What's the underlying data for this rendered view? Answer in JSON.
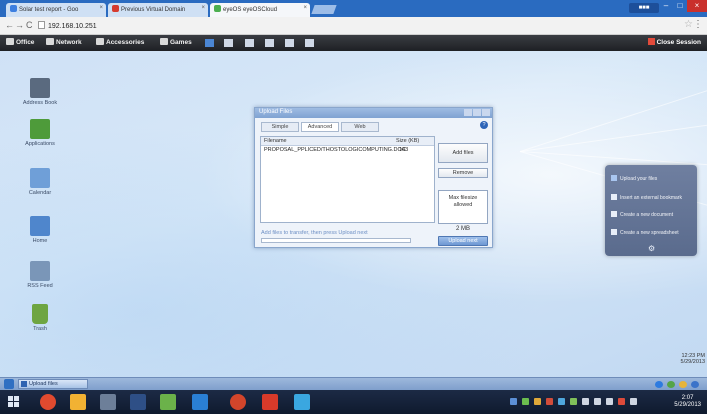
{
  "browser": {
    "tabs": [
      {
        "label": "Solar test report - Goo"
      },
      {
        "label": "Previous Virtual Domain"
      },
      {
        "label": "eyeOS eyeOSCloud"
      }
    ],
    "user_badge": "■■■",
    "address": "192.168.10.251",
    "star": "☆",
    "menu": "⋮"
  },
  "appbar": {
    "items": [
      "Office",
      "Network",
      "Accessories",
      "Games"
    ],
    "close_session": "Close Session"
  },
  "desktop_icons": [
    {
      "label": "Address Book",
      "color": "#5a6a7f"
    },
    {
      "label": "Applications",
      "color": "#4e9b3a"
    },
    {
      "label": "Calendar",
      "color": "#6f9fd8"
    },
    {
      "label": "Home",
      "color": "#4f86cc"
    },
    {
      "label": "RSS Feed",
      "color": "#7a96b8"
    },
    {
      "label": "Trash",
      "color": "#6ea541"
    }
  ],
  "dialog": {
    "title": "Upload Files",
    "tabs": [
      "Simple",
      "Advanced",
      "Web"
    ],
    "help": "?",
    "columns": [
      "Filename",
      "Size (KB)"
    ],
    "rows": [
      {
        "filename": "PROPOSAL_PPLICED/THOSTOLOGICOMPUTING.DOC",
        "size": "143"
      }
    ],
    "add_files": "Add files",
    "remove": "Remove",
    "max_label": "Max filesize allowed",
    "max_value": "2 MB",
    "hint": "Add files to transfer, then press Upload next",
    "upload": "Upload next"
  },
  "widget": {
    "items": [
      "Upload your files",
      "Insert an external bookmark",
      "Create a new document",
      "Create a new spreadsheet"
    ]
  },
  "os_taskbar": {
    "window_button": "Upload files",
    "clock": "12:23 PM 5/29/2013"
  },
  "win_clock": {
    "time": "2:07",
    "date": "5/29/2013"
  }
}
